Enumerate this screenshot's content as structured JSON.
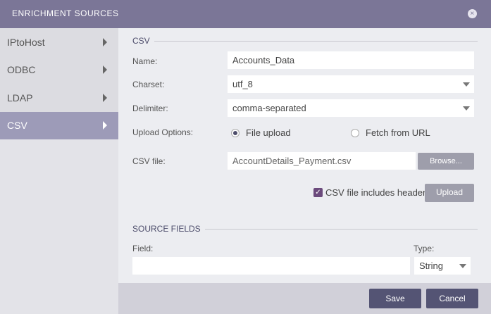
{
  "header": {
    "title": "ENRICHMENT SOURCES",
    "close_icon": "×"
  },
  "sidebar": {
    "items": [
      {
        "label": "IPtoHost"
      },
      {
        "label": "ODBC"
      },
      {
        "label": "LDAP"
      },
      {
        "label": "CSV",
        "selected": true
      }
    ]
  },
  "form": {
    "section_title": "CSV",
    "name_label": "Name:",
    "name_value": "Accounts_Data",
    "charset_label": "Charset:",
    "charset_value": "utf_8",
    "delimiter_label": "Delimiter:",
    "delimiter_value": "comma-separated",
    "upload_label": "Upload Options:",
    "opt_file": "File upload",
    "opt_url": "Fetch from URL",
    "selected_option": "File upload",
    "csvfile_label": "CSV file:",
    "csvfile_value": "AccountDetails_Payment.csv",
    "browse": "Browse...",
    "header_checkbox": "CSV file includes header",
    "header_checked": true,
    "upload": "Upload"
  },
  "source_fields": {
    "title": "SOURCE FIELDS",
    "field_label": "Field:",
    "field_value": "",
    "type_label": "Type:",
    "type_value": "String"
  },
  "footer": {
    "save": "Save",
    "cancel": "Cancel"
  }
}
